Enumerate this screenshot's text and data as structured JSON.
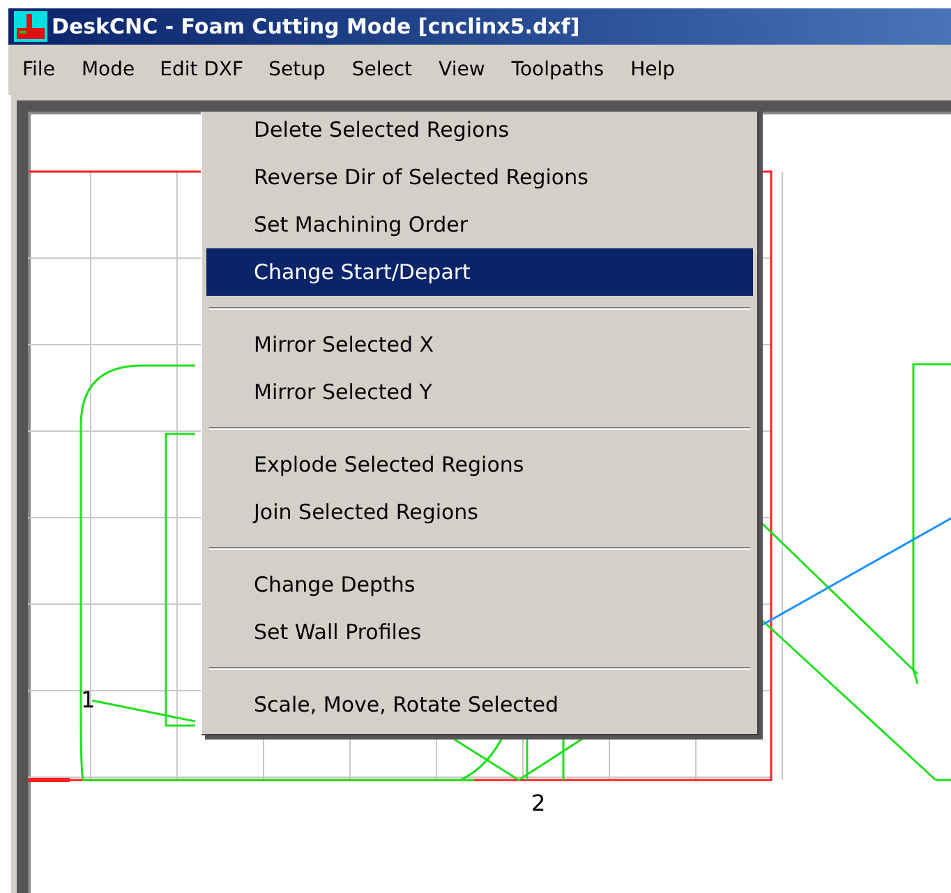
{
  "window": {
    "title": "DeskCNC - Foam Cutting Mode [cnclinx5.dxf]"
  },
  "menubar": [
    {
      "label": "File",
      "selected": false
    },
    {
      "label": "Mode",
      "selected": false
    },
    {
      "label": "Edit DXF",
      "selected": true
    },
    {
      "label": "Setup",
      "selected": false
    },
    {
      "label": "Select",
      "selected": false
    },
    {
      "label": "View",
      "selected": false
    },
    {
      "label": "Toolpaths",
      "selected": false
    },
    {
      "label": "Help",
      "selected": false
    }
  ],
  "menu": {
    "items": [
      {
        "kind": "item",
        "label": "Delete Selected Regions",
        "selected": false
      },
      {
        "kind": "item",
        "label": "Reverse Dir of Selected Regions",
        "selected": false
      },
      {
        "kind": "item",
        "label": "Set Machining Order",
        "selected": false
      },
      {
        "kind": "item",
        "label": "Change Start/Depart",
        "selected": true
      },
      {
        "kind": "separator"
      },
      {
        "kind": "item",
        "label": "Mirror Selected X",
        "selected": false
      },
      {
        "kind": "item",
        "label": "Mirror Selected Y",
        "selected": false
      },
      {
        "kind": "separator"
      },
      {
        "kind": "item",
        "label": "Explode Selected Regions",
        "selected": false
      },
      {
        "kind": "item",
        "label": "Join Selected Regions",
        "selected": false
      },
      {
        "kind": "separator"
      },
      {
        "kind": "item",
        "label": "Change Depths",
        "selected": false
      },
      {
        "kind": "item",
        "label": "Set Wall Profiles",
        "selected": false
      },
      {
        "kind": "separator"
      },
      {
        "kind": "item",
        "label": "Scale, Move, Rotate Selected",
        "selected": false
      }
    ]
  },
  "canvas": {
    "point_labels": [
      "1",
      "2"
    ]
  }
}
